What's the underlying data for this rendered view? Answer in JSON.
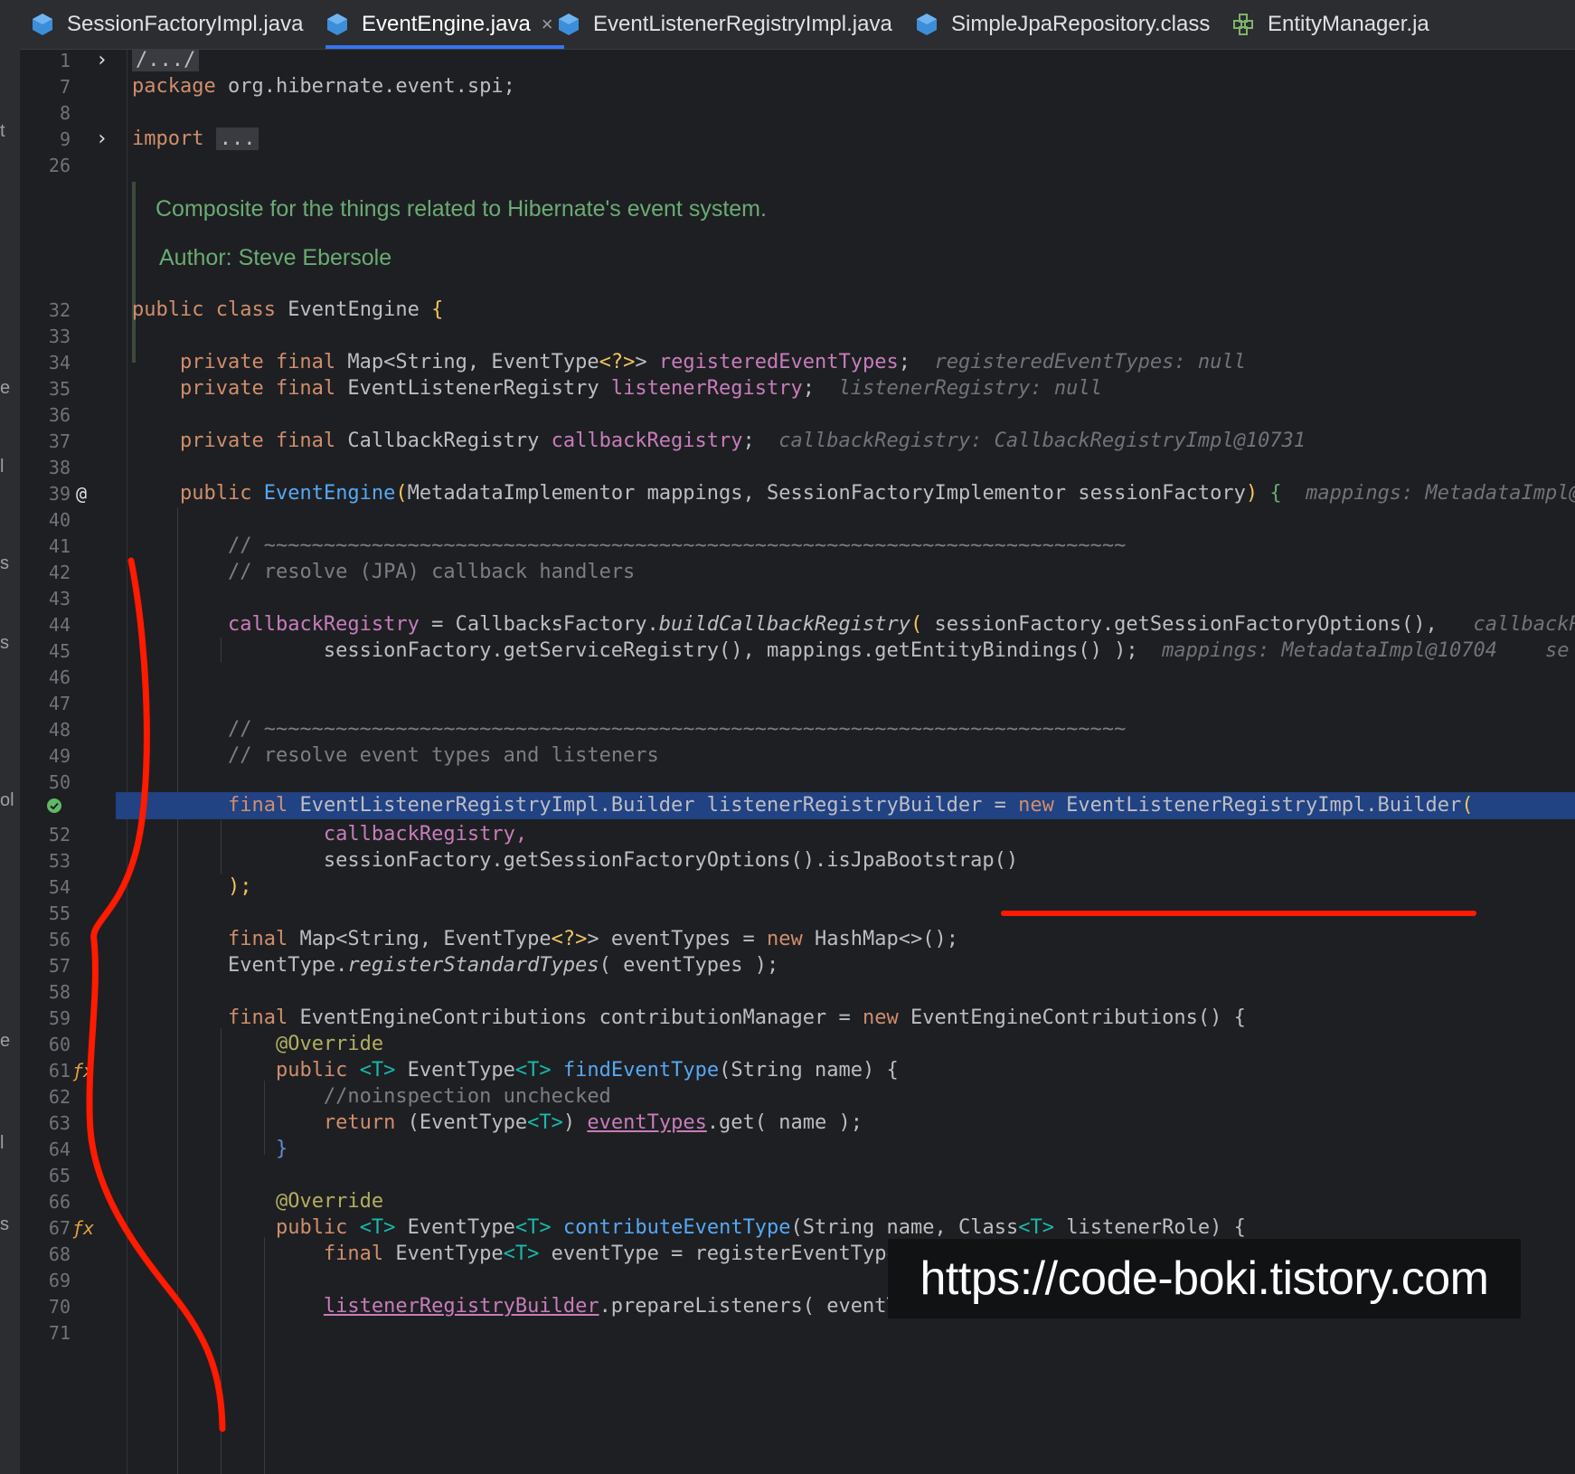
{
  "tabs": [
    {
      "label": "SessionFactoryImpl.java",
      "icon": "java-class-icon",
      "active": false
    },
    {
      "label": "EventEngine.java",
      "icon": "java-class-icon",
      "active": true,
      "close": "×"
    },
    {
      "label": "EventListenerRegistryImpl.java",
      "icon": "java-class-icon",
      "active": false
    },
    {
      "label": "SimpleJpaRepository.class",
      "icon": "java-class-icon",
      "active": false
    },
    {
      "label": "EntityManager.ja",
      "icon": "interface-icon",
      "active": false
    }
  ],
  "line_numbers": [
    "1",
    "7",
    "8",
    "9",
    "26",
    "32",
    "33",
    "34",
    "35",
    "36",
    "37",
    "38",
    "39",
    "40",
    "41",
    "42",
    "43",
    "44",
    "45",
    "46",
    "47",
    "48",
    "49",
    "50",
    "",
    "52",
    "53",
    "54",
    "55",
    "56",
    "57",
    "58",
    "59",
    "60",
    "61",
    "62",
    "63",
    "64",
    "65",
    "66",
    "67",
    "68",
    "69",
    "70",
    "71"
  ],
  "code": {
    "folded_header": "/.../",
    "package_kw": "package",
    "package_name": " org.hibernate.event.spi;",
    "import_kw": "import",
    "import_fold": "...",
    "doc_text": "Composite for the things related to Hibernate's event system.",
    "doc_author_label": "Author:",
    "doc_author": "Steve Ebersole",
    "class_decl": {
      "kw1": "public",
      "kw2": "class",
      "name": "EventEngine",
      "brace": "{"
    },
    "field1": {
      "kw": "private final",
      "type": "Map<String, EventType",
      "generic": "<?>",
      "close": ">",
      "name": "registeredEventTypes",
      "semi": ";",
      "hint": "registeredEventTypes: null"
    },
    "field2": {
      "kw": "private final",
      "type": "EventListenerRegistry",
      "name": "listenerRegistry",
      "semi": ";",
      "hint": "listenerRegistry: null"
    },
    "field3": {
      "kw": "private final",
      "type": "CallbackRegistry",
      "name": "callbackRegistry",
      "semi": ";",
      "hint": "callbackRegistry: CallbackRegistryImpl@10731"
    },
    "ctor": {
      "kw": "public",
      "name": "EventEngine",
      "paren": "(",
      "params": "MetadataImplementor mappings, SessionFactoryImplementor sessionFactory",
      "close": ")",
      "brace": "{",
      "hint": "mappings: MetadataImpl@"
    },
    "comment_tilde": "// ~~~~~~~~~~~~~~~~~~~~~~~~~~~~~~~~~~~~~~~~~~~~~~~~~~~~~~~~~~~~~~~~~~~~~~~~",
    "comment_callbacks": "// resolve (JPA) callback handlers",
    "l44": {
      "field": "callbackRegistry",
      "eq": " = CallbacksFactory.",
      "method": "buildCallbackRegistry",
      "paren": "(",
      "args": " sessionFactory.getSessionFactoryOptions(),",
      "hint": "callbackR"
    },
    "l45": {
      "text": "sessionFactory.getServiceRegistry(), mappings.getEntityBindings() );",
      "hint": "mappings: MetadataImpl@10704",
      "hint2": "se"
    },
    "comment_events": "// resolve event types and listeners",
    "l51": {
      "kw": "final",
      "text": " EventListenerRegistryImpl.Builder listenerRegistryBuilder = ",
      "new": "new",
      "rest": " EventListenerRegistryImpl.Builder",
      "paren": "("
    },
    "l52": "callbackRegistry,",
    "l53": "sessionFactory.getSessionFactoryOptions().isJpaBootstrap()",
    "l54": ");",
    "l56": {
      "kw": "final",
      "text": " Map<String, EventType",
      "generic": "<?>",
      "rest": "> eventTypes = ",
      "new": "new",
      "tail": " HashMap<>();"
    },
    "l57": {
      "cls": "EventType.",
      "method": "registerStandardTypes",
      "rest": "( eventTypes );"
    },
    "l59": {
      "kw": "final",
      "text": " EventEngineContributions contributionManager = ",
      "new": "new",
      "rest": " EventEngineContributions() {"
    },
    "override": "@Override",
    "l61": {
      "kw": "public",
      "gen": "<T>",
      "type": " EventType",
      "gen2": "<T>",
      "method": " findEventType",
      "rest": "(String name) {"
    },
    "l62": "//noinspection unchecked",
    "l63": {
      "kw": "return",
      "text": " (EventType",
      "gen": "<T>",
      "close": ") ",
      "field": "eventTypes",
      "rest": ".get( name );"
    },
    "l64": "}",
    "l67": {
      "kw": "public",
      "gen": "<T>",
      "type": " EventType",
      "gen2": "<T>",
      "method": " contributeEventType",
      "rest": "(String name, Class",
      "gen3": "<T>",
      "tail": " listenerRole) {"
    },
    "l68": {
      "kw": "final",
      "text": " EventType",
      "gen": "<T>",
      "rest": " eventType = registerEventType( name, listenerRole );"
    },
    "l70": {
      "field": "listenerRegistryBuilder",
      "rest": ".prepareListeners( eventType );"
    }
  },
  "gutter_icons": {
    "l39": "@",
    "l51": "✓",
    "l61": "ƒx",
    "l67": "ƒx"
  },
  "watermark": "https://code-boki.tistory.com",
  "left_strip": [
    "t",
    "e",
    "l",
    "s",
    "s",
    "ol",
    "e",
    "l",
    "s"
  ],
  "colors": {
    "keyword": "#cf8e6d",
    "field": "#c77dbb",
    "function": "#56a8f5",
    "highlight": "#214283",
    "annotation_red": "#ff1a00"
  }
}
